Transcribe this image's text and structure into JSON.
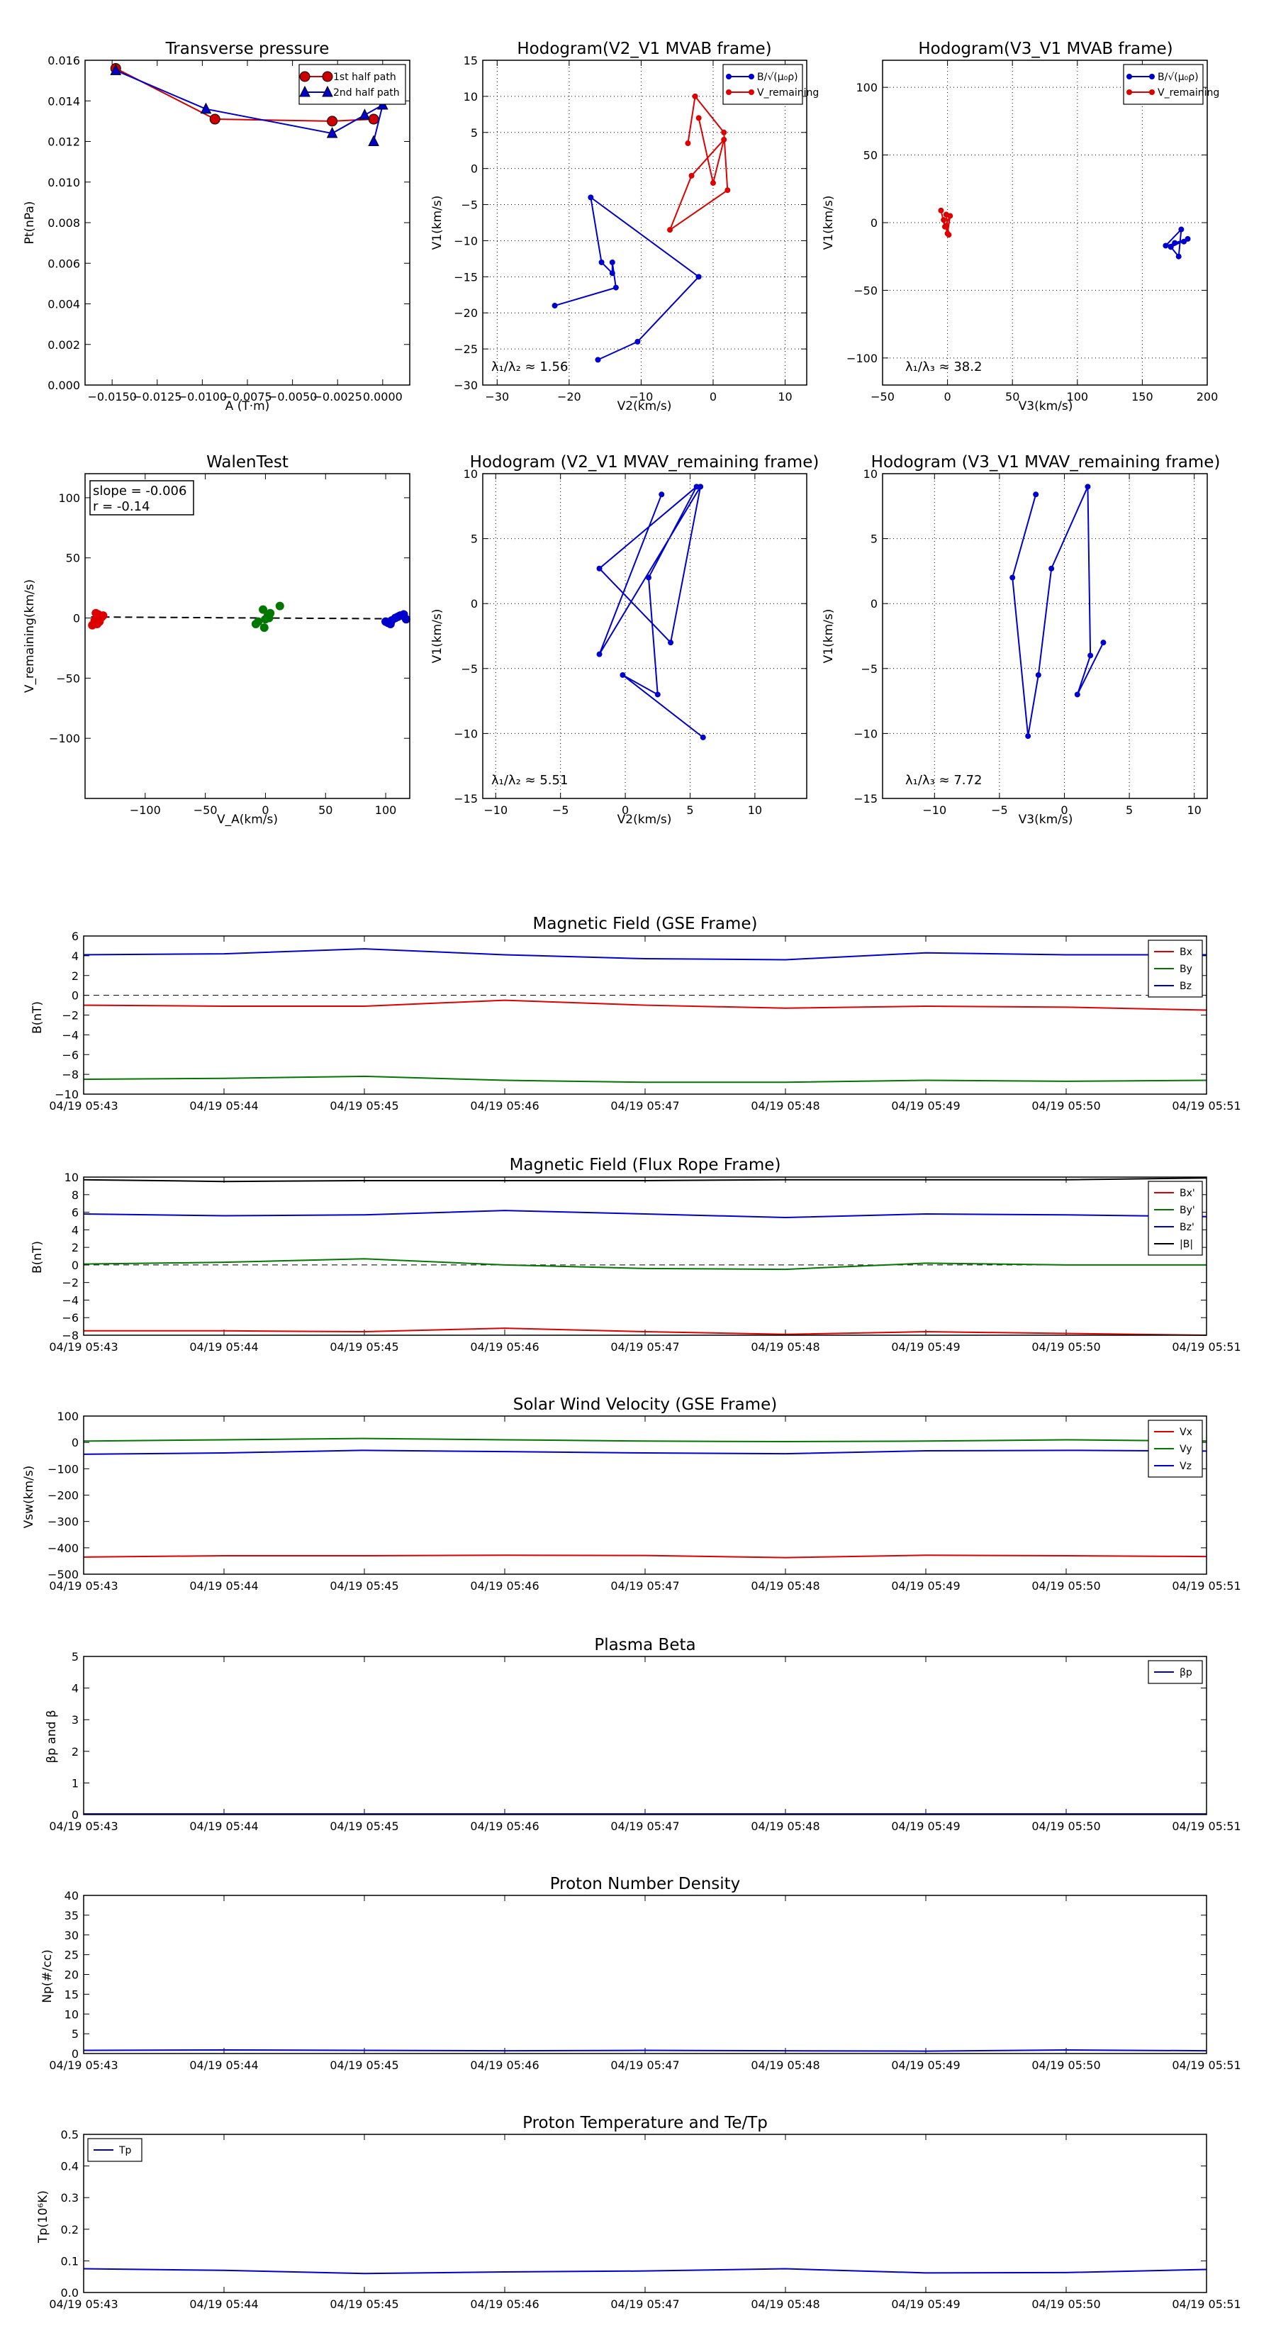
{
  "chart_data": [
    {
      "id": "tp",
      "type": "line",
      "title": "Transverse pressure",
      "xlabel": "A (T·m)",
      "ylabel": "Pt(nPa)",
      "xlim": [
        -0.0165,
        0.0015
      ],
      "ylim": [
        0,
        0.016
      ],
      "xticks": [
        -0.015,
        -0.0125,
        -0.01,
        -0.0075,
        -0.005,
        -0.0025,
        0.0
      ],
      "xtick_labels": [
        "−0.0150",
        "−0.0125",
        "−0.0100",
        "−0.0075",
        "−0.0050",
        "−0.0025",
        "0.0000"
      ],
      "yticks": [
        0,
        0.002,
        0.004,
        0.006,
        0.008,
        0.01,
        0.012,
        0.014,
        0.016
      ],
      "ytick_labels": [
        "0.000",
        "0.002",
        "0.004",
        "0.006",
        "0.008",
        "0.010",
        "0.012",
        "0.014",
        "0.016"
      ],
      "grid": false,
      "legend": "top-right",
      "series": [
        {
          "name": "1st half path",
          "color": "#cc0000",
          "marker": "circle",
          "x": [
            -0.0148,
            -0.0093,
            -0.0028,
            -0.0005
          ],
          "y": [
            0.0156,
            0.0131,
            0.013,
            0.0131
          ]
        },
        {
          "name": "2nd half path",
          "color": "#0000cc",
          "marker": "triangle",
          "x": [
            -0.0148,
            -0.0098,
            -0.0028,
            -0.001,
            0.0,
            -0.0005
          ],
          "y": [
            0.0155,
            0.0136,
            0.0124,
            0.0133,
            0.0138,
            0.012
          ]
        }
      ]
    },
    {
      "id": "h1",
      "type": "line",
      "title": "Hodogram(V2_V1 MVAB frame)",
      "xlabel": "V2(km/s)",
      "ylabel": "V1(km/s)",
      "xlim": [
        -32,
        13
      ],
      "ylim": [
        -30,
        15
      ],
      "xticks": [
        -30,
        -20,
        -10,
        0,
        10
      ],
      "xtick_labels": [
        "−30",
        "−20",
        "−10",
        "0",
        "10"
      ],
      "yticks": [
        -30,
        -25,
        -20,
        -15,
        -10,
        -5,
        0,
        5,
        10,
        15
      ],
      "ytick_labels": [
        "−30",
        "−25",
        "−20",
        "−15",
        "−10",
        "−5",
        "0",
        "5",
        "10",
        "15"
      ],
      "grid": true,
      "legend": "top-right",
      "annotation": "λ₁/λ₂ ≈ 1.56",
      "series": [
        {
          "name": "B/√(μ₀ρ)",
          "color": "#0000cc",
          "x": [
            -22,
            -13.5,
            -14,
            -14,
            -15.5,
            -17,
            -2,
            -10.5,
            -16
          ],
          "y": [
            -19,
            -16.5,
            -13,
            -14.5,
            -13,
            -4,
            -15,
            -24,
            -26.5
          ]
        },
        {
          "name": "V_remaining",
          "color": "#dd0000",
          "x": [
            -3.5,
            -2.5,
            1.5,
            2,
            -6,
            -3,
            1.5,
            0,
            -2
          ],
          "y": [
            3.5,
            10,
            5,
            -3,
            -8.5,
            -1,
            4,
            -2,
            7
          ]
        }
      ]
    },
    {
      "id": "h2",
      "type": "line",
      "title": "Hodogram(V3_V1 MVAB frame)",
      "xlabel": "V3(km/s)",
      "ylabel": "V1(km/s)",
      "xlim": [
        -50,
        200
      ],
      "ylim": [
        -120,
        120
      ],
      "xticks": [
        -50,
        0,
        50,
        100,
        150,
        200
      ],
      "xtick_labels": [
        "−50",
        "0",
        "50",
        "100",
        "150",
        "200"
      ],
      "yticks": [
        -100,
        -50,
        0,
        50,
        100
      ],
      "ytick_labels": [
        "−100",
        "−50",
        "0",
        "50",
        "100"
      ],
      "grid": true,
      "legend": "top-right",
      "annotation": "λ₁/λ₃ ≈ 38.2",
      "series": [
        {
          "name": "B/√(μ₀ρ)",
          "color": "#0000cc",
          "x": [
            175,
            185,
            172,
            178,
            180,
            168,
            182
          ],
          "y": [
            -15,
            -12,
            -18,
            -25,
            -5,
            -17,
            -14
          ]
        },
        {
          "name": "V_remaining",
          "color": "#dd0000",
          "x": [
            -5,
            -2,
            2,
            0,
            -3,
            1,
            -1
          ],
          "y": [
            9,
            -3,
            5,
            -8,
            2,
            -9,
            6
          ]
        }
      ]
    },
    {
      "id": "walen",
      "type": "scatter",
      "title": "WalenTest",
      "xlabel": "V_A(km/s)",
      "ylabel": "V_remaining(km/s)",
      "xlim": [
        -150,
        120
      ],
      "ylim": [
        -150,
        120
      ],
      "xticks": [
        -100,
        -50,
        0,
        50,
        100
      ],
      "xtick_labels": [
        "−100",
        "−50",
        "0",
        "50",
        "100"
      ],
      "yticks": [
        -100,
        -50,
        0,
        50,
        100
      ],
      "ytick_labels": [
        "−100",
        "−50",
        "0",
        "50",
        "100"
      ],
      "grid": false,
      "annotation_lines": [
        "slope = -0.006",
        "r = -0.14"
      ],
      "fit_line": {
        "slope": -0.006,
        "intercept": 0,
        "x": [
          -145,
          118
        ]
      },
      "series": [
        {
          "color": "#dd0000",
          "x": [
            -142,
            -139,
            -137,
            -140,
            -135,
            -141,
            -138,
            -136,
            -144
          ],
          "y": [
            -2,
            3,
            0,
            -5,
            2,
            4,
            -3,
            1,
            -6
          ]
        },
        {
          "color": "#007700",
          "x": [
            -8,
            -2,
            2,
            12,
            -1,
            4,
            0,
            -6,
            3
          ],
          "y": [
            -5,
            7,
            2,
            10,
            -8,
            4,
            -1,
            -3,
            0
          ]
        },
        {
          "color": "#0000cc",
          "x": [
            102,
            105,
            108,
            112,
            115,
            104,
            110,
            117,
            100
          ],
          "y": [
            -4,
            -2,
            0,
            2,
            3,
            -5,
            1,
            -1,
            -3
          ]
        }
      ]
    },
    {
      "id": "h3",
      "type": "line",
      "title": "Hodogram (V2_V1 MVAV_remaining frame)",
      "xlabel": "V2(km/s)",
      "ylabel": "V1(km/s)",
      "xlim": [
        -11,
        14
      ],
      "ylim": [
        -15,
        10
      ],
      "xticks": [
        -10,
        -5,
        0,
        5,
        10
      ],
      "xtick_labels": [
        "−10",
        "−5",
        "0",
        "5",
        "10"
      ],
      "yticks": [
        -15,
        -10,
        -5,
        0,
        5,
        10
      ],
      "ytick_labels": [
        "−15",
        "−10",
        "−5",
        "0",
        "5",
        "10"
      ],
      "grid": true,
      "annotation": "λ₁/λ₂ ≈ 5.51",
      "series": [
        {
          "color": "#0000cc",
          "x": [
            2.8,
            -2,
            5.8,
            3.5,
            -2,
            5.5,
            1.8,
            2.5,
            -0.2,
            6
          ],
          "y": [
            8.4,
            -3.9,
            9,
            -3,
            2.7,
            9,
            2,
            -7,
            -5.5,
            -10.3
          ]
        }
      ]
    },
    {
      "id": "h4",
      "type": "line",
      "title": "Hodogram (V3_V1 MVAV_remaining frame)",
      "xlabel": "V3(km/s)",
      "ylabel": "V1(km/s)",
      "xlim": [
        -14,
        11
      ],
      "ylim": [
        -15,
        10
      ],
      "xticks": [
        -10,
        -5,
        0,
        5,
        10
      ],
      "xtick_labels": [
        "−10",
        "−5",
        "0",
        "5",
        "10"
      ],
      "yticks": [
        -15,
        -10,
        -5,
        0,
        5,
        10
      ],
      "ytick_labels": [
        "−15",
        "−10",
        "−5",
        "0",
        "5",
        "10"
      ],
      "grid": true,
      "annotation": "λ₁/λ₃ ≈ 7.72",
      "series": [
        {
          "color": "#0000cc",
          "x": [
            -2.2,
            -4,
            -2.8,
            -2,
            -1,
            1.8,
            2,
            1,
            3
          ],
          "y": [
            8.4,
            2,
            -10.2,
            -5.5,
            2.7,
            9,
            -4,
            -7,
            -3
          ]
        }
      ]
    },
    {
      "id": "bgse",
      "type": "line",
      "title": "Magnetic Field (GSE Frame)",
      "ylabel": "B(nT)",
      "x": [
        "04/19 05:43",
        "04/19 05:44",
        "04/19 05:45",
        "04/19 05:46",
        "04/19 05:47",
        "04/19 05:48",
        "04/19 05:49",
        "04/19 05:50",
        "04/19 05:51"
      ],
      "ylim": [
        -10,
        6
      ],
      "yticks": [
        -10,
        -8,
        -6,
        -4,
        -2,
        0,
        2,
        4,
        6
      ],
      "ytick_labels": [
        "−10",
        "−8",
        "−6",
        "−4",
        "−2",
        "0",
        "2",
        "4",
        "6"
      ],
      "zero_line": true,
      "legend": "top-right",
      "series": [
        {
          "name": "Bx",
          "color": "#dd0000",
          "values": [
            -1.0,
            -1.1,
            -1.1,
            -0.5,
            -1.0,
            -1.3,
            -1.1,
            -1.2,
            -1.5
          ]
        },
        {
          "name": "By",
          "color": "#007700",
          "values": [
            -8.5,
            -8.4,
            -8.2,
            -8.6,
            -8.8,
            -8.8,
            -8.6,
            -8.7,
            -8.6
          ]
        },
        {
          "name": "Bz",
          "color": "#0000cc",
          "values": [
            4.1,
            4.2,
            4.7,
            4.1,
            3.7,
            3.6,
            4.3,
            4.1,
            4.1
          ]
        }
      ]
    },
    {
      "id": "bfr",
      "type": "line",
      "title": "Magnetic Field (Flux Rope Frame)",
      "ylabel": "B(nT)",
      "x": [
        "04/19 05:43",
        "04/19 05:44",
        "04/19 05:45",
        "04/19 05:46",
        "04/19 05:47",
        "04/19 05:48",
        "04/19 05:49",
        "04/19 05:50",
        "04/19 05:51"
      ],
      "ylim": [
        -8,
        10
      ],
      "yticks": [
        -8,
        -6,
        -4,
        -2,
        0,
        2,
        4,
        6,
        8,
        10
      ],
      "ytick_labels": [
        "−8",
        "−6",
        "−4",
        "−2",
        "0",
        "2",
        "4",
        "6",
        "8",
        "10"
      ],
      "zero_line": true,
      "legend": "top-right",
      "series": [
        {
          "name": "Bx'",
          "color": "#dd0000",
          "values": [
            -7.5,
            -7.5,
            -7.6,
            -7.2,
            -7.6,
            -7.9,
            -7.6,
            -7.8,
            -8.0
          ]
        },
        {
          "name": "By'",
          "color": "#007700",
          "values": [
            0.1,
            0.3,
            0.7,
            0.0,
            -0.4,
            -0.5,
            0.2,
            0.0,
            0.0
          ]
        },
        {
          "name": "Bz'",
          "color": "#0000cc",
          "values": [
            5.8,
            5.6,
            5.7,
            6.2,
            5.8,
            5.4,
            5.8,
            5.7,
            5.5
          ]
        },
        {
          "name": "|B|",
          "color": "#000000",
          "values": [
            9.7,
            9.5,
            9.6,
            9.6,
            9.6,
            9.7,
            9.7,
            9.7,
            9.9
          ]
        }
      ]
    },
    {
      "id": "vsw",
      "type": "line",
      "title": "Solar Wind Velocity (GSE Frame)",
      "ylabel": "Vsw(km/s)",
      "x": [
        "04/19 05:43",
        "04/19 05:44",
        "04/19 05:45",
        "04/19 05:46",
        "04/19 05:47",
        "04/19 05:48",
        "04/19 05:49",
        "04/19 05:50",
        "04/19 05:51"
      ],
      "ylim": [
        -500,
        100
      ],
      "yticks": [
        -500,
        -400,
        -300,
        -200,
        -100,
        0,
        100
      ],
      "ytick_labels": [
        "−500",
        "−400",
        "−300",
        "−200",
        "−100",
        "0",
        "100"
      ],
      "legend": "top-right",
      "series": [
        {
          "name": "Vx",
          "color": "#dd0000",
          "values": [
            -435,
            -430,
            -430,
            -428,
            -429,
            -437,
            -428,
            -430,
            -433
          ]
        },
        {
          "name": "Vy",
          "color": "#007700",
          "values": [
            5,
            10,
            15,
            10,
            5,
            3,
            5,
            10,
            5
          ]
        },
        {
          "name": "Vz",
          "color": "#0000cc",
          "values": [
            -45,
            -40,
            -30,
            -35,
            -40,
            -43,
            -32,
            -30,
            -33
          ]
        }
      ]
    },
    {
      "id": "beta",
      "type": "line",
      "title": "Plasma Beta",
      "ylabel": "βp and β",
      "x": [
        "04/19 05:43",
        "04/19 05:44",
        "04/19 05:45",
        "04/19 05:46",
        "04/19 05:47",
        "04/19 05:48",
        "04/19 05:49",
        "04/19 05:50",
        "04/19 05:51"
      ],
      "ylim": [
        0,
        5
      ],
      "yticks": [
        0,
        1,
        2,
        3,
        4,
        5
      ],
      "ytick_labels": [
        "0",
        "1",
        "2",
        "3",
        "4",
        "5"
      ],
      "legend": "top-right",
      "series": [
        {
          "name": "βp",
          "color": "#0000cc",
          "values": [
            0.02,
            0.02,
            0.02,
            0.02,
            0.02,
            0.02,
            0.02,
            0.02,
            0.02
          ]
        }
      ]
    },
    {
      "id": "np",
      "type": "line",
      "title": "Proton Number Density",
      "ylabel": "Np(#/cc)",
      "x": [
        "04/19 05:43",
        "04/19 05:44",
        "04/19 05:45",
        "04/19 05:46",
        "04/19 05:47",
        "04/19 05:48",
        "04/19 05:49",
        "04/19 05:50",
        "04/19 05:51"
      ],
      "ylim": [
        0,
        40
      ],
      "yticks": [
        0,
        5,
        10,
        15,
        20,
        25,
        30,
        35,
        40
      ],
      "ytick_labels": [
        "0",
        "5",
        "10",
        "15",
        "20",
        "25",
        "30",
        "35",
        "40"
      ],
      "series": [
        {
          "color": "#0000cc",
          "values": [
            0.8,
            0.9,
            0.8,
            0.7,
            0.8,
            0.7,
            0.6,
            0.9,
            0.7
          ]
        }
      ]
    },
    {
      "id": "tp2",
      "type": "line",
      "title": "Proton Temperature and Te/Tp",
      "ylabel": "Tp(10⁶K)",
      "x": [
        "04/19 05:43",
        "04/19 05:44",
        "04/19 05:45",
        "04/19 05:46",
        "04/19 05:47",
        "04/19 05:48",
        "04/19 05:49",
        "04/19 05:50",
        "04/19 05:51"
      ],
      "ylim": [
        0,
        0.5
      ],
      "yticks": [
        0,
        0.1,
        0.2,
        0.3,
        0.4,
        0.5
      ],
      "ytick_labels": [
        "0.0",
        "0.1",
        "0.2",
        "0.3",
        "0.4",
        "0.5"
      ],
      "legend": "top-left",
      "series": [
        {
          "name": "Tp",
          "color": "#0000cc",
          "values": [
            0.075,
            0.07,
            0.06,
            0.065,
            0.068,
            0.075,
            0.062,
            0.063,
            0.073
          ]
        }
      ]
    }
  ]
}
